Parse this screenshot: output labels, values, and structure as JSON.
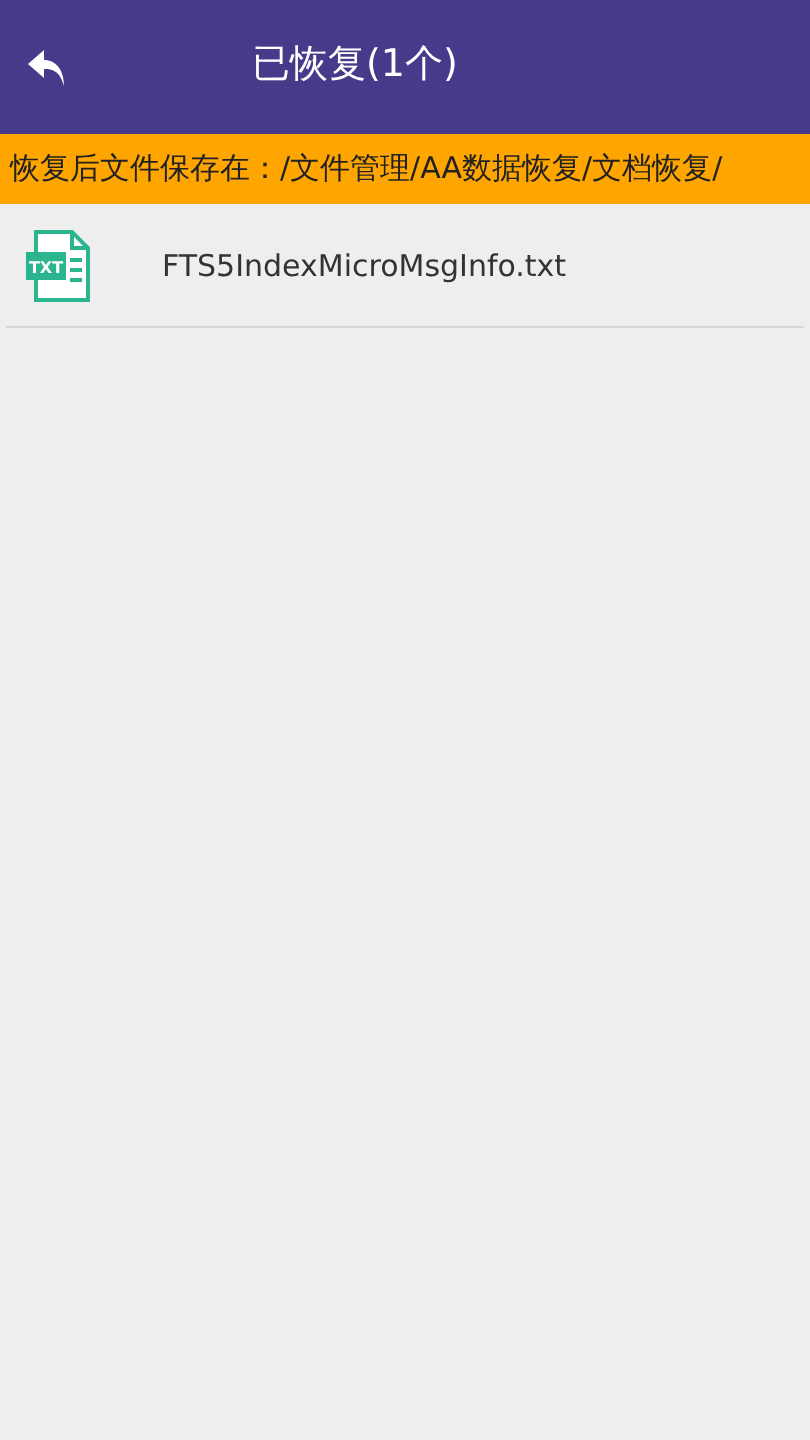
{
  "header": {
    "title": "已恢复(1个)"
  },
  "notice": {
    "text": "恢复后文件保存在：/文件管理/AA数据恢复/文档恢复/"
  },
  "files": [
    {
      "type_label": "TXT",
      "name": "FTS5IndexMicroMsgInfo.txt"
    }
  ]
}
